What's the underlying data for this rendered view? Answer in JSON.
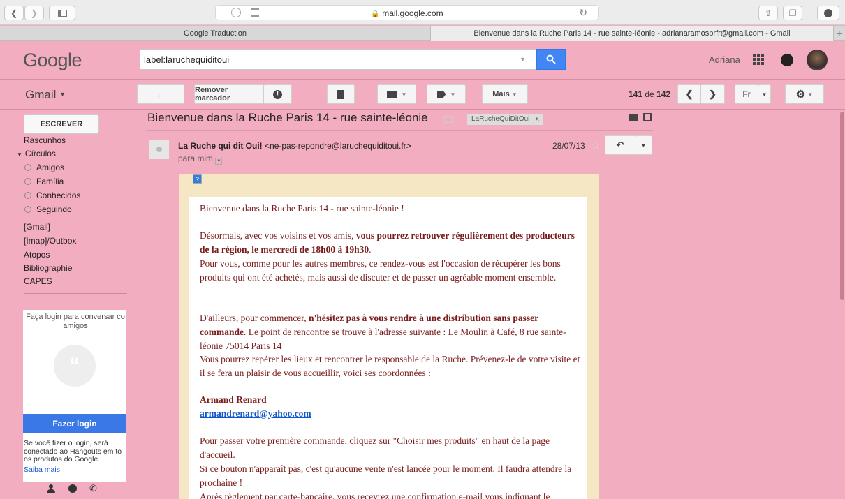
{
  "browser": {
    "url": "mail.google.com",
    "tabs": [
      {
        "label": "Google Traduction"
      },
      {
        "label": "Bienvenue dans la Ruche Paris 14 - rue sainte-léonie - adrianaramosbrfr@gmail.com - Gmail"
      }
    ]
  },
  "header": {
    "logo": "Google",
    "search_value": "label:laruchequiditoui",
    "user_name": "Adriana"
  },
  "toolbar": {
    "gmail_label": "Gmail",
    "remove_label": "Remover marcador",
    "more_label": "Mais",
    "page_current": "141",
    "page_of": "de",
    "page_total": "142",
    "language": "Fr"
  },
  "sidebar": {
    "compose": "ESCREVER",
    "items": [
      {
        "label": "Rascunhos"
      },
      {
        "label": "Círculos"
      },
      {
        "label": "Amigos"
      },
      {
        "label": "Família"
      },
      {
        "label": "Conhecidos"
      },
      {
        "label": "Seguindo"
      },
      {
        "label": "[Gmail]"
      },
      {
        "label": "[Imap]/Outbox"
      },
      {
        "label": "Atopos"
      },
      {
        "label": "Bibliographie"
      },
      {
        "label": "CAPES"
      }
    ],
    "chat": {
      "prompt": "Faça login para conversar co amigos",
      "login_button": "Fazer login",
      "info": "Se você fizer o login, será conectado ao Hangouts em to os produtos do Google",
      "learn_more": "Saiba mais"
    }
  },
  "message": {
    "subject": "Bienvenue dans la Ruche Paris 14 - rue sainte-léonie",
    "label_chip": "LaRucheQuiDitOui",
    "label_chip_close": "x",
    "sender_name": "La Ruche qui dit Oui!",
    "sender_email": "<ne-pas-repondre@laruchequiditoui.fr>",
    "recipient": "para mim",
    "date": "28/07/13",
    "body": {
      "p1": "Bienvenue dans la Ruche Paris 14 - rue sainte-léonie !",
      "p2_a": "Désormais, avec vos voisins et vos amis, ",
      "p2_b": "vous pourrez retrouver régulièrement des producteurs de la région, le mercredi de 18h00 à 19h30",
      "p2_c": ".",
      "p3": "Pour vous, comme pour les autres membres, ce rendez-vous est l'occasion de récupérer les bons produits qui ont été achetés, mais aussi de discuter et de passer un agréable moment ensemble.",
      "p4_a": "D'ailleurs, pour commencer, ",
      "p4_b": "n'hésitez pas à vous rendre à une distribution sans passer commande",
      "p4_c": ". Le point de rencontre se trouve à l'adresse suivante : Le Moulin à Café, 8 rue sainte-léonie 75014 Paris 14",
      "p5": "Vous pourrez repérer les lieux et rencontrer le responsable de la Ruche. Prévenez-le de votre visite et il se fera un plaisir de vous accueillir, voici ses coordonnées :",
      "contact_name": "Armand Renard",
      "contact_email": "armandrenard@yahoo.com",
      "p6": "Pour passer votre première commande, cliquez sur \"Choisir mes produits\" en haut de la page d'accueil.",
      "p7": "Si ce bouton n'apparaît pas, c'est qu'aucune vente n'est lancée pour le moment. Il faudra attendre la prochaine !",
      "p8": "Après règlement par carte-bancaire, vous recevrez une confirmation e-mail vous indiquant le"
    }
  },
  "colors": {
    "theme_pink": "#f3adc0",
    "search_blue": "#4285f4",
    "body_text": "#7b1c1c",
    "frame": "#f5e6c4"
  }
}
